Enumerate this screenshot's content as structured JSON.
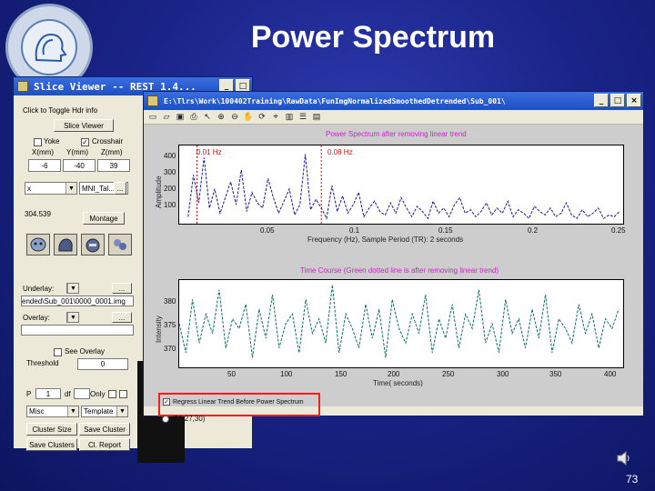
{
  "slide": {
    "title": "Power Spectrum",
    "page_number": "73"
  },
  "slice_viewer": {
    "title": "Slice Viewer -- REST 1.4...",
    "hint": "Click to Toggle Hdr info",
    "panel_title": "Slice Viewer",
    "yoke_label": "Yoke",
    "crosshair_label": "Crosshair",
    "coord_labels": [
      "X(mm)",
      "Y(mm)",
      "Z(mm)"
    ],
    "coord_values": [
      "-6",
      "-40",
      "39"
    ],
    "axis_select": "x",
    "template_select": "MNI_Tal...",
    "value_readout": "304.539",
    "montage_label": "Montage",
    "underlay_label": "Underlay:",
    "underlay_file": "ended\\Sub_001\\0000_0001.img",
    "overlay_label": "Overlay:",
    "see_overlay_label": "See Overlay",
    "threshold_label": "Threshold",
    "threshold_value": "0",
    "p_label": "P",
    "p_value": "1",
    "df_label": "df",
    "only_label": "Only",
    "misc_select": "Misc",
    "template_btn": "Template",
    "cluster_size_btn": "Cluster Size",
    "save_cluster_btn": "Save Cluster",
    "save_clusters_btn": "Save Clusters",
    "cl_report_btn": "Cl. Report",
    "browse_btn": "..."
  },
  "spectrum_window": {
    "title": "E:\\Tlrs\\Work\\100402Training\\RawData\\FunImgNormalizedSmoothedDetrended\\Sub_001\\",
    "top_title": "Power Spectrum after removing linear trend",
    "top_ylabel": "Amplitude",
    "top_xlabel": "Frequency (Hz), Sample Period (TR): 2 seconds",
    "marker1": "0.01 Hz",
    "marker2": "0.08 Hz",
    "top_yticks": [
      "400",
      "300",
      "200",
      "100"
    ],
    "top_xticks": [
      "0.05",
      "0.1",
      "0.15",
      "0.2",
      "0.25"
    ],
    "bottom_title": "Time Course (Green dotted line is after removing linear trend)",
    "bottom_ylabel": "Intensity",
    "bottom_xlabel": "Time( seconds)",
    "bottom_yticks": [
      "380",
      "375",
      "370"
    ],
    "bottom_xticks": [
      "50",
      "100",
      "150",
      "200",
      "250",
      "300",
      "350",
      "400"
    ],
    "regress_label": "Regress Linear Trend Before Power Spectrum",
    "radio_label": "(59,27,30)"
  },
  "chart_data": [
    {
      "type": "line",
      "title": "Power Spectrum after removing linear trend",
      "xlabel": "Frequency (Hz), Sample Period (TR): 2 seconds",
      "ylabel": "Amplitude",
      "xlim": [
        0,
        0.25
      ],
      "ylim": [
        0,
        450
      ],
      "series": [
        {
          "x": [
            0.005,
            0.008,
            0.011,
            0.014,
            0.017,
            0.02,
            0.023,
            0.026,
            0.029,
            0.032,
            0.035,
            0.038,
            0.041,
            0.044,
            0.047,
            0.05,
            0.053,
            0.056,
            0.059,
            0.062,
            0.065,
            0.068,
            0.071,
            0.074,
            0.077,
            0.08,
            0.083,
            0.086,
            0.089,
            0.092,
            0.095,
            0.098,
            0.101,
            0.104,
            0.107,
            0.11,
            0.113,
            0.116,
            0.119,
            0.122,
            0.125,
            0.128,
            0.131,
            0.134,
            0.137,
            0.14,
            0.143,
            0.146,
            0.149,
            0.152,
            0.155,
            0.158,
            0.161,
            0.164,
            0.167,
            0.17,
            0.173,
            0.176,
            0.179,
            0.182,
            0.185,
            0.188,
            0.191,
            0.194,
            0.197,
            0.2,
            0.203,
            0.206,
            0.209,
            0.212,
            0.215,
            0.218,
            0.221,
            0.224,
            0.227,
            0.23,
            0.233,
            0.236,
            0.239,
            0.242,
            0.245,
            0.248
          ],
          "values": [
            40,
            280,
            120,
            380,
            90,
            200,
            60,
            150,
            240,
            110,
            310,
            70,
            180,
            120,
            90,
            260,
            150,
            60,
            130,
            200,
            50,
            110,
            400,
            80,
            140,
            90,
            30,
            220,
            70,
            160,
            60,
            110,
            180,
            40,
            90,
            130,
            70,
            50,
            120,
            60,
            150,
            90,
            40,
            100,
            70,
            30,
            130,
            60,
            90,
            40,
            110,
            150,
            60,
            80,
            40,
            70,
            120,
            50,
            90,
            60,
            130,
            40,
            80,
            60,
            30,
            100,
            70,
            50,
            90,
            40,
            60,
            120,
            50,
            30,
            80,
            40,
            60,
            90,
            30,
            50,
            40,
            70
          ]
        }
      ]
    },
    {
      "type": "line",
      "title": "Time Course (Green dotted line is after removing linear trend)",
      "xlabel": "Time( seconds)",
      "ylabel": "Intensity",
      "xlim": [
        0,
        400
      ],
      "ylim": [
        366,
        384
      ],
      "series": [
        {
          "x": [
            0,
            6,
            12,
            18,
            24,
            30,
            36,
            42,
            48,
            54,
            60,
            66,
            72,
            78,
            84,
            90,
            96,
            102,
            108,
            114,
            120,
            126,
            132,
            138,
            144,
            150,
            156,
            162,
            168,
            174,
            180,
            186,
            192,
            198,
            204,
            210,
            216,
            222,
            228,
            234,
            240,
            246,
            252,
            258,
            264,
            270,
            276,
            282,
            288,
            294,
            300,
            306,
            312,
            318,
            324,
            330,
            336,
            342,
            348,
            354,
            360,
            366,
            372,
            378,
            384,
            390,
            396
          ],
          "values": [
            375,
            369,
            380,
            371,
            377,
            373,
            382,
            370,
            376,
            374,
            379,
            368,
            378,
            372,
            381,
            370,
            375,
            377,
            369,
            380,
            373,
            376,
            371,
            383,
            369,
            377,
            374,
            370,
            379,
            372,
            378,
            368,
            380,
            374,
            371,
            377,
            373,
            381,
            369,
            376,
            372,
            379,
            370,
            377,
            374,
            382,
            371,
            375,
            369,
            380,
            373,
            376,
            370,
            378,
            372,
            381,
            369,
            376,
            374,
            371,
            379,
            373,
            377,
            370,
            376,
            374,
            378
          ]
        }
      ]
    }
  ]
}
